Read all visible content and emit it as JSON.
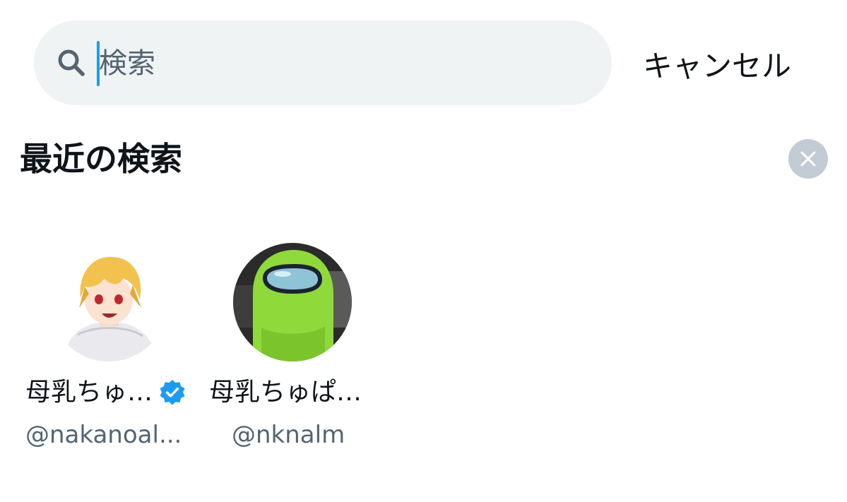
{
  "search": {
    "placeholder": "検索",
    "icon": "search-icon",
    "caret_color": "#1d9bf0"
  },
  "header": {
    "cancel_label": "キャンセル"
  },
  "recent": {
    "title": "最近の検索",
    "clear_icon": "close-icon",
    "accounts": [
      {
        "display_name": "母乳ちゅ…",
        "handle": "@nakanoal...",
        "verified": true,
        "avatar": "anime-character-avatar"
      },
      {
        "display_name": "母乳ちゅぱ…",
        "handle": "@nknalm",
        "verified": false,
        "avatar": "green-plush-avatar"
      }
    ]
  },
  "colors": {
    "accent": "#1d9bf0",
    "search_bg": "#eff3f4",
    "secondary_text": "#536471",
    "clear_button_bg": "#c3ccd5"
  }
}
